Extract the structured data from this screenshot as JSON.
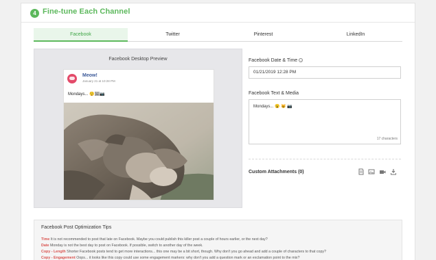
{
  "section": {
    "step": "4",
    "title": "Fine-tune Each Channel"
  },
  "tabs": [
    "Facebook",
    "Twitter",
    "Pinterest",
    "LinkedIn"
  ],
  "preview": {
    "title": "Facebook Desktop Preview",
    "post": {
      "name": "Meow!",
      "date": "January 21 at 10:28 PM",
      "text": "Mondays... 😲🖼📷"
    }
  },
  "datetime": {
    "label": "Facebook Date & Time",
    "value": "01/21/2019 12:28 PM"
  },
  "text_media": {
    "label": "Facebook Text & Media",
    "value": "Mondays... 😮 😺 📷",
    "char_count": "17 characters"
  },
  "attachments": {
    "label": "Custom Attachments (0)",
    "icons": [
      "document-icon",
      "image-icon",
      "video-icon",
      "download-icon"
    ]
  },
  "tips": {
    "title": "Facebook Post Optimization Tips",
    "items": [
      {
        "key": "Time",
        "text": "It is not recommended to post that late on Facebook. Maybe you could publish this killer post a couple of hours earlier, or the next day?"
      },
      {
        "key": "Date",
        "text": "Monday is not the best day to post on Facebook. If possible, switch to another day of the week."
      },
      {
        "key": "Copy - Length",
        "text": "Shorter Facebook posts tend to get more interactions... this one may be a bit short, though. Why don't you go ahead and add a couple of characters to that copy?"
      },
      {
        "key": "Copy - Engagement",
        "text": "Oops... it looks like this copy could use some engagement markers: why don't you add a question mark or an exclamation point to the mix?"
      }
    ]
  },
  "colors": {
    "accent": "#5cb85c",
    "tip_key": "#d9534f",
    "fb_blue": "#3b5998"
  }
}
